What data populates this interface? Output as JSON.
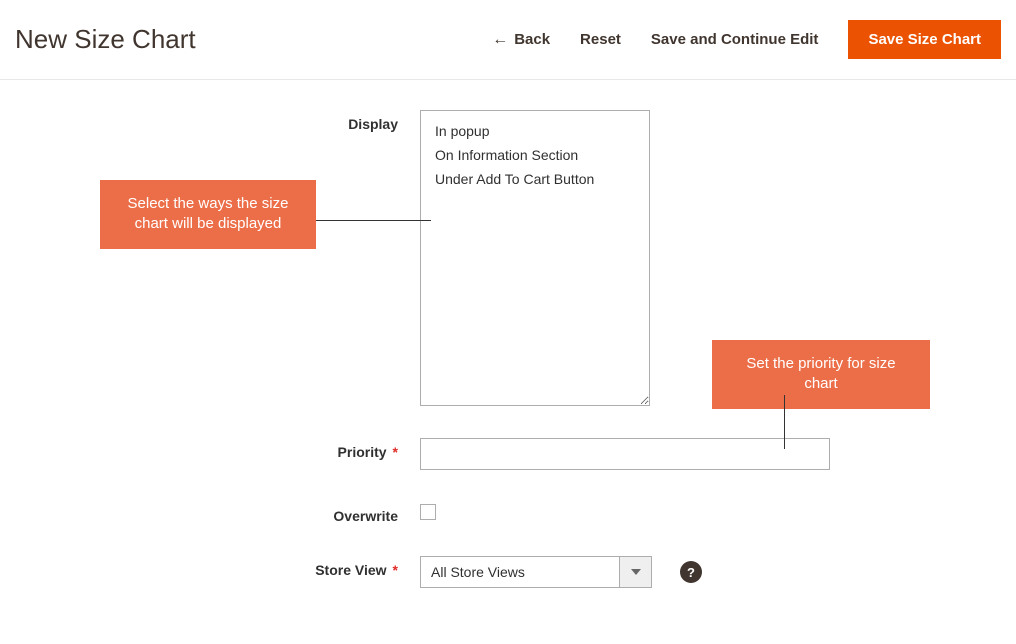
{
  "header": {
    "title": "New Size Chart",
    "back": "Back",
    "reset": "Reset",
    "save_continue": "Save and Continue Edit",
    "save": "Save Size Chart"
  },
  "form": {
    "display_label": "Display",
    "display_options": {
      "0": "In popup",
      "1": "On Information Section",
      "2": "Under Add To Cart Button"
    },
    "priority_label": "Priority",
    "priority_value": "",
    "overwrite_label": "Overwrite",
    "storeview_label": "Store View",
    "storeview_value": "All Store Views"
  },
  "callouts": {
    "display": "Select the ways the size chart will be displayed",
    "priority": "Set the priority for size chart"
  }
}
